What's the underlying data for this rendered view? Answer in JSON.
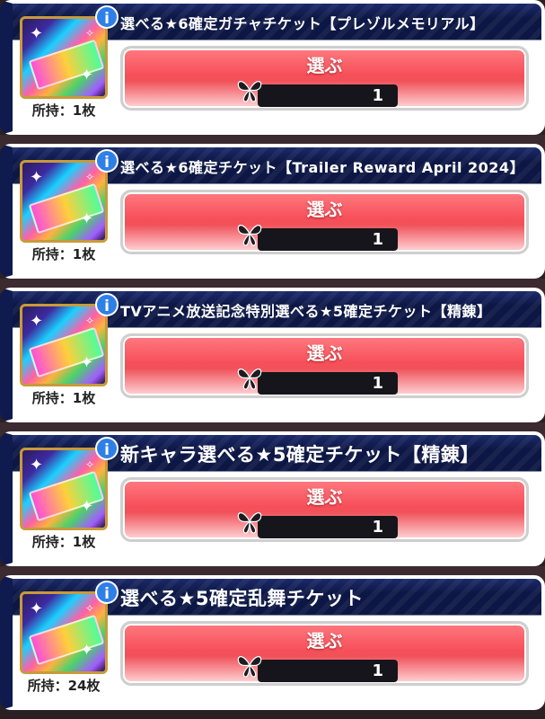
{
  "tickets": [
    {
      "title": "選べる★6確定ガチャチケット【プレゾルメモリアル】",
      "owned": "所持：1枚",
      "select_label": "選ぶ",
      "cost": "1",
      "title_style": "normal"
    },
    {
      "title": "選べる★6確定チケット【Trailer Reward April 2024】",
      "owned": "所持：1枚",
      "select_label": "選ぶ",
      "cost": "1",
      "title_style": "normal"
    },
    {
      "title": "TVアニメ放送記念特別選べる★5確定チケット【精錬】",
      "owned": "所持：1枚",
      "select_label": "選ぶ",
      "cost": "1",
      "title_style": "normal"
    },
    {
      "title": "新キャラ選べる★5確定チケット【精錬】",
      "owned": "所持：1枚",
      "select_label": "選ぶ",
      "cost": "1",
      "title_style": "big"
    },
    {
      "title": "選べる★5確定乱舞チケット",
      "owned": "所持：24枚",
      "select_label": "選ぶ",
      "cost": "1",
      "title_style": "big"
    }
  ],
  "colors": {
    "header_navy": "#0d1745",
    "button_red": "#f74f59",
    "info_blue": "#2f7fe8",
    "thumb_border_gold": "#c99a3a"
  },
  "icons": {
    "info": "info-icon",
    "cost": "butterfly-icon"
  }
}
